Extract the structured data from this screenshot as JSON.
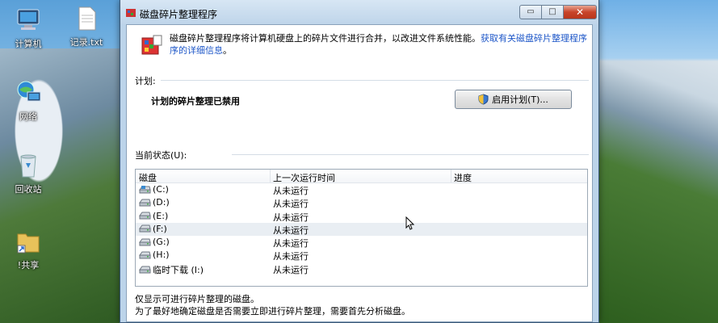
{
  "desktop": {
    "icons": [
      {
        "label": "计算机",
        "name": "computer"
      },
      {
        "label": "记录.txt",
        "name": "text-file"
      },
      {
        "label": "网络",
        "name": "network"
      },
      {
        "label": "回收站",
        "name": "recycle-bin"
      },
      {
        "label": "!共享",
        "name": "share-folder"
      }
    ]
  },
  "window": {
    "title": "磁盘碎片整理程序",
    "min_glyph": "▭",
    "max_glyph": "□",
    "close_glyph": "✕"
  },
  "intro": {
    "text": "磁盘碎片整理程序将计算机硬盘上的碎片文件进行合并，以改进文件系统性能。",
    "link1": "获取有关磁盘碎片整理程序",
    "link2": "序的详细信息",
    "tail": "。"
  },
  "schedule": {
    "group_label": "计划:",
    "status": "计划的碎片整理已禁用",
    "button": "启用计划(T)..."
  },
  "current": {
    "group_label": "当前状态(U):",
    "columns": [
      "磁盘",
      "上一次运行时间",
      "进度"
    ],
    "rows": [
      {
        "disk": "(C:)",
        "last_run": "从未运行",
        "progress": "",
        "icon": "system-drive-icon"
      },
      {
        "disk": "(D:)",
        "last_run": "从未运行",
        "progress": "",
        "icon": "drive-icon"
      },
      {
        "disk": "(E:)",
        "last_run": "从未运行",
        "progress": "",
        "icon": "drive-icon"
      },
      {
        "disk": "(F:)",
        "last_run": "从未运行",
        "progress": "",
        "icon": "drive-icon"
      },
      {
        "disk": "(G:)",
        "last_run": "从未运行",
        "progress": "",
        "icon": "drive-icon"
      },
      {
        "disk": "(H:)",
        "last_run": "从未运行",
        "progress": "",
        "icon": "drive-icon"
      },
      {
        "disk": "临时下载 (I:)",
        "last_run": "从未运行",
        "progress": "",
        "icon": "drive-icon"
      }
    ]
  },
  "footer": {
    "line1": "仅显示可进行碎片整理的磁盘。",
    "line2": "为了最好地确定磁盘是否需要立即进行碎片整理，需要首先分析磁盘。"
  },
  "colors": {
    "link": "#1e57c8",
    "selected_row": "#e9eef3",
    "close_button": "#c8442a"
  }
}
